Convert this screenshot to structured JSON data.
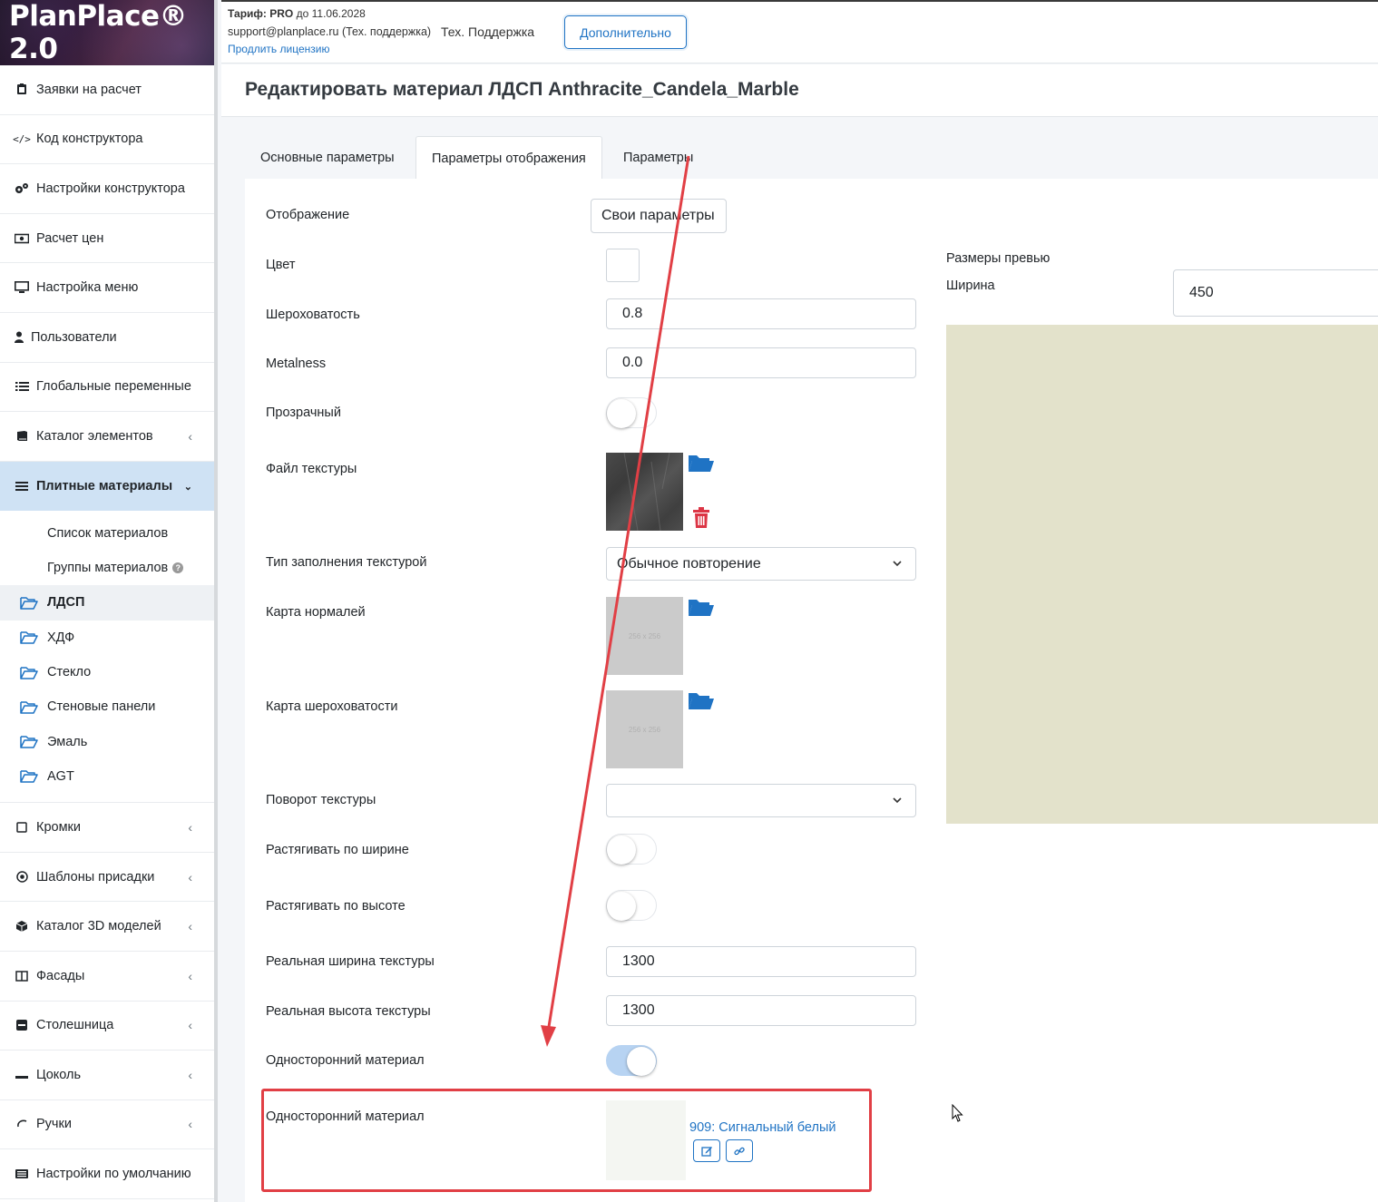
{
  "app": {
    "logo_text": "PlanPlace® 2.0"
  },
  "topbar": {
    "tariff_label": "Тариф:",
    "tariff_plan": "PRO",
    "tariff_until": "до 11.06.2028",
    "support_email": "support@planplace.ru (Тех. поддержка)",
    "renew_link": "Продлить лицензию",
    "tech_support": "Тех. Поддержка",
    "more_button": "Дополнительно"
  },
  "sidebar": {
    "items_top": [
      {
        "label": "Заявки на расчет",
        "icon": "clipboard-icon"
      },
      {
        "label": "Код конструктора",
        "icon": "code-icon"
      },
      {
        "label": "Настройки конструктора",
        "icon": "gears-icon"
      },
      {
        "label": "Расчет цен",
        "icon": "money-icon"
      },
      {
        "label": "Настройка меню",
        "icon": "monitor-icon"
      },
      {
        "label": "Пользователи",
        "icon": "user-icon"
      },
      {
        "label": "Глобальные переменные",
        "icon": "list-icon"
      },
      {
        "label": "Каталог элементов",
        "icon": "book-icon"
      }
    ],
    "active_section": "Плитные материалы",
    "subitems": [
      "Список материалов",
      "Группы материалов"
    ],
    "folders": [
      "ЛДСП",
      "ХДФ",
      "Стекло",
      "Стеновые панели",
      "Эмаль",
      "AGT"
    ],
    "items_bottom": [
      {
        "label": "Кромки",
        "icon": "square-icon"
      },
      {
        "label": "Шаблоны присадки",
        "icon": "target-icon"
      },
      {
        "label": "Каталог 3D моделей",
        "icon": "cube-icon"
      },
      {
        "label": "Фасады",
        "icon": "columns-icon"
      },
      {
        "label": "Столешница",
        "icon": "minus-square-icon"
      },
      {
        "label": "Цоколь",
        "icon": "line-icon"
      },
      {
        "label": "Ручки",
        "icon": "handle-icon"
      },
      {
        "label": "Настройки по умолчанию",
        "icon": "settings-list-icon"
      }
    ]
  },
  "page": {
    "title": "Редактировать материал ЛДСП Anthracite_Candela_Marble",
    "tabs": [
      "Основные параметры",
      "Параметры отображения",
      "Параметры"
    ]
  },
  "form": {
    "display_label": "Отображение",
    "display_value": "Свои параметры",
    "color_label": "Цвет",
    "roughness_label": "Шероховатость",
    "roughness_value": "0.8",
    "metalness_label": "Metalness",
    "metalness_value": "0.0",
    "transparent_label": "Прозрачный",
    "texture_file_label": "Файл текстуры",
    "fill_type_label": "Тип заполнения текстурой",
    "fill_type_value": "Обычное повторение",
    "normal_map_label": "Карта нормалей",
    "placeholder_text": "256 x 256",
    "roughness_map_label": "Карта шероховатости",
    "rotation_label": "Поворот текстуры",
    "rotation_value": "",
    "stretch_w_label": "Растягивать по ширине",
    "stretch_h_label": "Растягивать по высоте",
    "real_w_label": "Реальная ширина текстуры",
    "real_w_value": "1300",
    "real_h_label": "Реальная высота текстуры",
    "real_h_value": "1300",
    "one_sided_label": "Односторонний материал",
    "one_sided_on": true,
    "one_sided_mat_label": "Односторонний материал",
    "one_sided_mat_link": "909: Сигнальный белый"
  },
  "preview": {
    "title": "Размеры превью",
    "width_label": "Ширина",
    "width_value": "450",
    "color": "#e3e2cb"
  },
  "colors": {
    "accent": "#1f73c4",
    "highlight": "#e13f45",
    "active_nav": "#cfe2f4"
  }
}
